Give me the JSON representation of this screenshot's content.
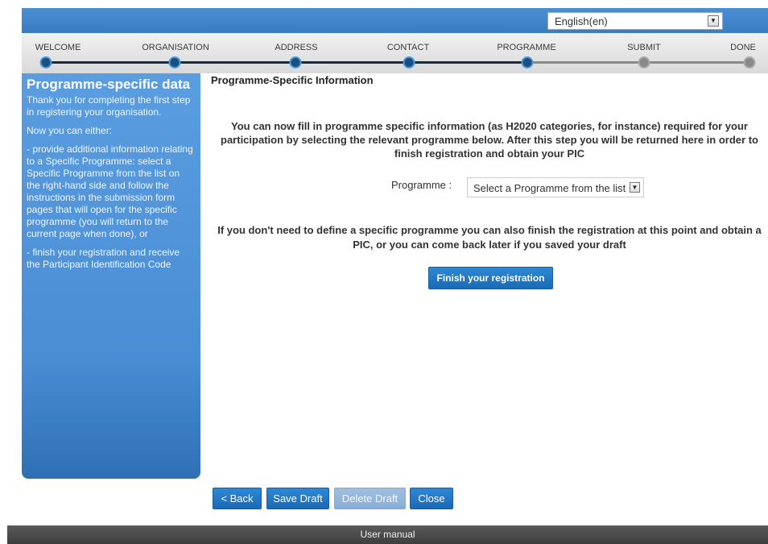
{
  "language": {
    "selected": "English(en)"
  },
  "steps": [
    {
      "label": "WELCOME",
      "state": "done"
    },
    {
      "label": "ORGANISATION",
      "state": "done"
    },
    {
      "label": "ADDRESS",
      "state": "done"
    },
    {
      "label": "CONTACT",
      "state": "done"
    },
    {
      "label": "PROGRAMME",
      "state": "current"
    },
    {
      "label": "SUBMIT",
      "state": "todo"
    },
    {
      "label": "DONE",
      "state": "todo"
    }
  ],
  "sidebar": {
    "title": "Programme-specific data",
    "paragraphs": [
      "Thank you for completing the first step in registering your organisation.",
      "Now you can either:",
      "- provide additional information relating to a Specific Programme: select a Specific Programme from the list on the right-hand side and follow the instructions in the submission form pages that will open for the specific programme (you will return to the current page when done), or",
      "- finish your registration and receive the Participant Identification Code"
    ]
  },
  "main": {
    "section_title": "Programme-Specific Information",
    "intro": "You can now fill in programme specific information (as H2020 categories, for instance) required for your participation by selecting the relevant programme below. After this step you will be returned here in order to finish registration and obtain your PIC",
    "programme_label": "Programme :",
    "programme_select": "Select a Programme from the list",
    "note": "If you don't need to define a specific programme you can also finish the registration at this point and obtain a PIC, or you can come back later if you saved your draft",
    "finish_button": "Finish your registration"
  },
  "actions": {
    "back": "< Back",
    "save_draft": "Save Draft",
    "delete_draft": "Delete Draft",
    "close": "Close"
  },
  "footer": {
    "user_manual": "User manual"
  },
  "colors": {
    "accent": "#1a69b5",
    "sidebar": "#4a8dd4",
    "step_done": "#1c4f7c",
    "step_todo": "#888888"
  }
}
